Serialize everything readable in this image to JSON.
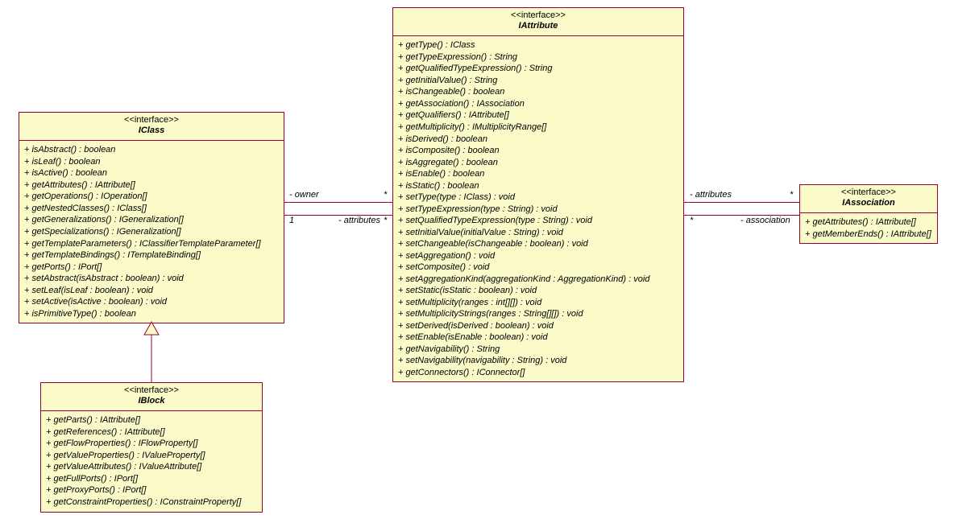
{
  "stereotype_label": "<<interface>>",
  "iclass": {
    "name": "IClass",
    "ops": [
      "+ isAbstract() : boolean",
      "+ isLeaf() : boolean",
      "+ isActive() : boolean",
      "+ getAttributes() : IAttribute[]",
      "+ getOperations() : IOperation[]",
      "+ getNestedClasses() : IClass[]",
      "+ getGeneralizations() : IGeneralization[]",
      "+ getSpecializations() : IGeneralization[]",
      "+ getTemplateParameters() : IClassifierTemplateParameter[]",
      "+ getTemplateBindings() : ITemplateBinding[]",
      "+ getPorts() : IPort[]",
      "+ setAbstract(isAbstract : boolean) : void",
      "+ setLeaf(isLeaf : boolean) : void",
      "+ setActive(isActive : boolean) : void",
      "+ isPrimitiveType() : boolean"
    ]
  },
  "iattribute": {
    "name": "IAttribute",
    "ops": [
      "+ getType() : IClass",
      "+ getTypeExpression() : String",
      "+ getQualifiedTypeExpression() : String",
      "+ getInitialValue() : String",
      "+ isChangeable() : boolean",
      "+ getAssociation() : IAssociation",
      "+ getQualifiers() : IAttribute[]",
      "+ getMultiplicity() : IMultiplicityRange[]",
      "+ isDerived() : boolean",
      "+ isComposite() : boolean",
      "+ isAggregate() : boolean",
      "+ isEnable() : boolean",
      "+ isStatic() : boolean",
      "+ setType(type : IClass) : void",
      "+ setTypeExpression(type : String) : void",
      "+ setQualifiedTypeExpression(type : String) : void",
      "+ setInitialValue(initialValue : String) : void",
      "+ setChangeable(isChangeable : boolean) : void",
      "+ setAggregation() : void",
      "+ setComposite() : void",
      "+ setAggregationKind(aggregationKind : AggregationKind) : void",
      "+ setStatic(isStatic : boolean) : void",
      "+ setMultiplicity(ranges : int[][]) : void",
      "+ setMultiplicityStrings(ranges : String[][]) : void",
      "+ setDerived(isDerived : boolean) : void",
      "+ setEnable(isEnable : boolean) : void",
      "+ getNavigability() : String",
      "+ setNavigability(navigability : String) : void",
      "+ getConnectors() : IConnector[]"
    ]
  },
  "iblock": {
    "name": "IBlock",
    "ops": [
      "+ getParts() : IAttribute[]",
      "+ getReferences() : IAttribute[]",
      "+ getFlowProperties() : IFlowProperty[]",
      "+ getValueProperties() : IValueProperty[]",
      "+ getValueAttributes() : IValueAttribute[]",
      "+ getFullPorts() : IPort[]",
      "+ getProxyPorts() : IPort[]",
      "+ getConstraintProperties() : IConstraintProperty[]"
    ]
  },
  "iassociation": {
    "name": "IAssociation",
    "ops": [
      "+ getAttributes() : IAttribute[]",
      "+ getMemberEnds() : IAttribute[]"
    ]
  },
  "assoc_iclass_iattr": {
    "owner_label": "- owner",
    "attributes_label": "- attributes",
    "mult_iclass": "1",
    "mult_attr_top": "*",
    "mult_attr_bottom": "*"
  },
  "assoc_iattr_iassoc": {
    "attributes_label": "- attributes",
    "association_label": "- association",
    "mult_attr_top": "*",
    "mult_attr_bottom": "*"
  }
}
